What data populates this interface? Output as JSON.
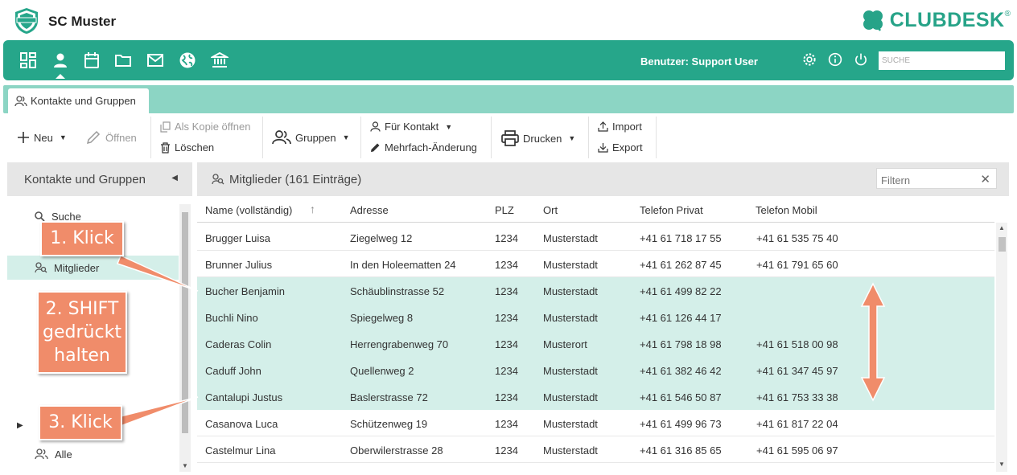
{
  "header": {
    "club_name": "SC Muster",
    "brand": "CLUBDESK",
    "brand_mark": "®",
    "brand_color": "#27a388"
  },
  "nav": {
    "color": "#26a68a",
    "icons": [
      "dashboard-icon",
      "contacts-icon",
      "calendar-icon",
      "folder-icon",
      "mail-icon",
      "globe-icon",
      "bank-icon"
    ],
    "active": "contacts-icon",
    "user_label": "Benutzer: Support User",
    "search_placeholder": "SUCHE"
  },
  "tabs": [
    {
      "label": "Kontakte und Gruppen"
    }
  ],
  "toolbar": {
    "new_label": "Neu",
    "open_label": "Öffnen",
    "open_copy_label": "Als Kopie öffnen",
    "delete_label": "Löschen",
    "groups_label": "Gruppen",
    "for_contact_label": "Für Kontakt",
    "bulk_edit_label": "Mehrfach-Änderung",
    "print_label": "Drucken",
    "import_label": "Import",
    "export_label": "Export"
  },
  "sidebar": {
    "title": "Kontakte und Gruppen",
    "items": [
      {
        "label": "Suche"
      },
      {
        "label": "Mitglieder",
        "selected": true
      },
      {
        "label": "Alle"
      }
    ]
  },
  "main": {
    "title": "Mitglieder (161 Einträge)",
    "filter_placeholder": "Filtern",
    "columns": [
      "Name (vollständig)",
      "Adresse",
      "PLZ",
      "Ort",
      "Telefon Privat",
      "Telefon Mobil"
    ],
    "rows": [
      {
        "name": "Brugger Luisa",
        "address": "Ziegelweg 12",
        "zip": "1234",
        "city": "Musterstadt",
        "phone": "+41 61 718 17 55",
        "mobile": "+41 61 535 75 40",
        "selected": false
      },
      {
        "name": "Brunner Julius",
        "address": "In den Holeematten 24",
        "zip": "1234",
        "city": "Musterstadt",
        "phone": "+41 61 262 87 45",
        "mobile": "+41 61 791 65 60",
        "selected": false
      },
      {
        "name": "Bucher Benjamin",
        "address": "Schäublinstrasse 52",
        "zip": "1234",
        "city": "Musterstadt",
        "phone": "+41 61 499 82 22",
        "mobile": "",
        "selected": true
      },
      {
        "name": "Buchli Nino",
        "address": "Spiegelweg 8",
        "zip": "1234",
        "city": "Musterstadt",
        "phone": "+41 61 126 44 17",
        "mobile": "",
        "selected": true
      },
      {
        "name": "Caderas Colin",
        "address": "Herrengrabenweg 70",
        "zip": "1234",
        "city": "Musterort",
        "phone": "+41 61 798 18 98",
        "mobile": "+41 61 518 00 98",
        "selected": true
      },
      {
        "name": "Caduff John",
        "address": "Quellenweg 2",
        "zip": "1234",
        "city": "Musterstadt",
        "phone": "+41 61 382 46 42",
        "mobile": "+41 61 347 45 97",
        "selected": true
      },
      {
        "name": "Cantalupi Justus",
        "address": "Baslerstrasse 72",
        "zip": "1234",
        "city": "Musterstadt",
        "phone": "+41 61 546 50 87",
        "mobile": "+41 61 753 33 38",
        "selected": true
      },
      {
        "name": "Casanova Luca",
        "address": "Schützenweg 19",
        "zip": "1234",
        "city": "Musterstadt",
        "phone": "+41 61 499 96 73",
        "mobile": "+41 61 817 22 04",
        "selected": false
      },
      {
        "name": "Castelmur Lina",
        "address": "Oberwilerstrasse 28",
        "zip": "1234",
        "city": "Musterstadt",
        "phone": "+41 61 316 85 65",
        "mobile": "+41 61 595 06 97",
        "selected": false
      }
    ],
    "selection_color": "#d4efe9"
  },
  "annotations": {
    "step1": "1. Klick",
    "step2_line1": "2. SHIFT",
    "step2_line2": "gedrückt",
    "step2_line3": "halten",
    "step3": "3. Klick",
    "color": "#f08c6a"
  }
}
